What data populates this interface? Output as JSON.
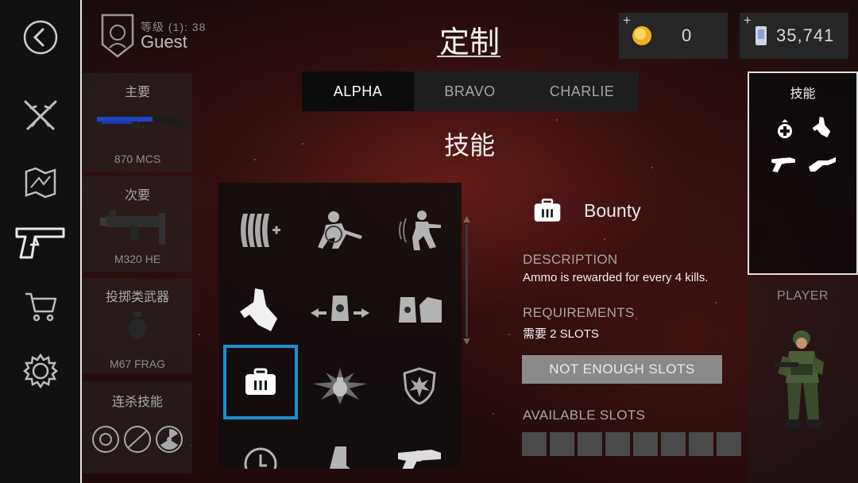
{
  "header": {
    "rank_label": "等级 (1): 38",
    "player_name": "Guest",
    "page_title": "定制",
    "coins": {
      "value": "0",
      "plus": "+"
    },
    "cash": {
      "value": "35,741",
      "plus": "+"
    }
  },
  "sidebar": {
    "items": [
      {
        "icon": "back-arrow-icon"
      },
      {
        "icon": "crossed-rifles-icon"
      },
      {
        "icon": "map-icon"
      },
      {
        "icon": "pistol-icon"
      },
      {
        "icon": "shopping-cart-icon"
      },
      {
        "icon": "gear-icon"
      }
    ]
  },
  "loadout": {
    "primary": {
      "heading": "主要",
      "name": "870 MCS"
    },
    "secondary": {
      "heading": "次要",
      "name": "M320 HE"
    },
    "throwable": {
      "heading": "投掷类武器",
      "name": "M67 FRAG"
    },
    "killstreak": {
      "heading": "连杀技能"
    }
  },
  "tabs": [
    {
      "label": "ALPHA",
      "active": true
    },
    {
      "label": "BRAVO",
      "active": false
    },
    {
      "label": "CHARLIE",
      "active": false
    }
  ],
  "section_title": "技能",
  "perks": [
    {
      "icon": "extra-ammo-icon"
    },
    {
      "icon": "crouching-soldier-icon"
    },
    {
      "icon": "running-soldier-icon"
    },
    {
      "icon": "grabbing-hand-icon"
    },
    {
      "icon": "move-sideways-icon"
    },
    {
      "icon": "turret-fast-icon"
    },
    {
      "icon": "ammo-case-icon",
      "selected": true
    },
    {
      "icon": "grenade-blast-icon"
    },
    {
      "icon": "blast-shield-icon"
    },
    {
      "icon": "stopwatch-icon"
    },
    {
      "icon": "boot-icon"
    },
    {
      "icon": "revolver-icon"
    }
  ],
  "detail": {
    "icon": "ammo-case-icon",
    "name": "Bounty",
    "description_label": "DESCRIPTION",
    "description": "Ammo is rewarded for every 4 kills.",
    "requirements_label": "REQUIREMENTS",
    "requirements": "需要 2 SLOTS",
    "button_label": "NOT ENOUGH SLOTS",
    "slots_label": "AVAILABLE SLOTS",
    "slots_total": 8
  },
  "skills_panel": {
    "heading": "技能",
    "icons": [
      "medic-plus-icon",
      "grabbing-hand-icon",
      "revolver-icon",
      "sniper-rifle-icon"
    ]
  },
  "player_panel": {
    "heading": "PLAYER"
  },
  "colors": {
    "accent_selected": "#1e8fc9",
    "button_disabled": "#8a8a8a",
    "coin_gold": "#f2b01e"
  }
}
